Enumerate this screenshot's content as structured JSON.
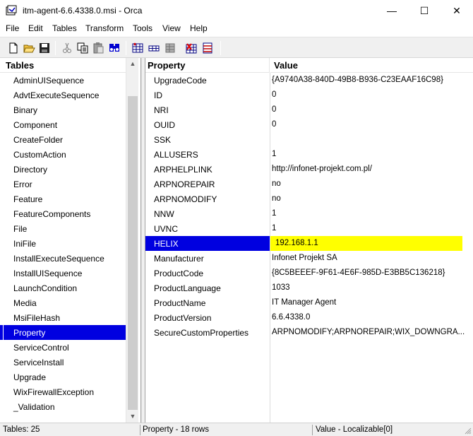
{
  "window": {
    "title": "itm-agent-6.6.4338.0.msi - Orca",
    "minimize_glyph": "—",
    "maximize_glyph": "☐",
    "close_glyph": "✕"
  },
  "menu": [
    {
      "label": "File"
    },
    {
      "label": "Edit"
    },
    {
      "label": "Tables"
    },
    {
      "label": "Transform"
    },
    {
      "label": "Tools"
    },
    {
      "label": "View"
    },
    {
      "label": "Help"
    }
  ],
  "toolbar": {
    "icons": [
      "new-file-icon",
      "open-folder-icon",
      "save-icon",
      "cut-icon",
      "copy-icon",
      "paste-icon",
      "find-icon",
      "add-table-icon",
      "add-row-icon",
      "drop-table-icon",
      "error-icon",
      "validate-icon"
    ]
  },
  "tables_pane": {
    "header": "Tables",
    "items": [
      {
        "label": "AdminUISequence"
      },
      {
        "label": "AdvtExecuteSequence"
      },
      {
        "label": "Binary"
      },
      {
        "label": "Component"
      },
      {
        "label": "CreateFolder"
      },
      {
        "label": "CustomAction"
      },
      {
        "label": "Directory"
      },
      {
        "label": "Error"
      },
      {
        "label": "Feature"
      },
      {
        "label": "FeatureComponents"
      },
      {
        "label": "File"
      },
      {
        "label": "IniFile"
      },
      {
        "label": "InstallExecuteSequence"
      },
      {
        "label": "InstallUISequence"
      },
      {
        "label": "LaunchCondition"
      },
      {
        "label": "Media"
      },
      {
        "label": "MsiFileHash"
      },
      {
        "label": "Property",
        "selected": true
      },
      {
        "label": "ServiceControl"
      },
      {
        "label": "ServiceInstall"
      },
      {
        "label": "Upgrade"
      },
      {
        "label": "WixFirewallException"
      },
      {
        "label": "_Validation"
      }
    ]
  },
  "grid": {
    "columns": {
      "property": "Property",
      "value": "Value"
    },
    "rows": [
      {
        "property": "UpgradeCode",
        "value": "{A9740A38-840D-49B8-B936-C23EAAF16C98}"
      },
      {
        "property": "ID",
        "value": "0"
      },
      {
        "property": "NRI",
        "value": "0"
      },
      {
        "property": "OUID",
        "value": "0"
      },
      {
        "property": "SSK",
        "value": ""
      },
      {
        "property": "ALLUSERS",
        "value": "1"
      },
      {
        "property": "ARPHELPLINK",
        "value": "http://infonet-projekt.com.pl/"
      },
      {
        "property": "ARPNOREPAIR",
        "value": "no"
      },
      {
        "property": "ARPNOMODIFY",
        "value": "no"
      },
      {
        "property": "NNW",
        "value": "1"
      },
      {
        "property": "UVNC",
        "value": "1"
      },
      {
        "property": "HELIX",
        "value": "192.168.1.1",
        "selected": true
      },
      {
        "property": "Manufacturer",
        "value": "Infonet Projekt SA"
      },
      {
        "property": "ProductCode",
        "value": "{8C5BEEEF-9F61-4E6F-985D-E3BB5C136218}"
      },
      {
        "property": "ProductLanguage",
        "value": "1033"
      },
      {
        "property": "ProductName",
        "value": "IT Manager Agent"
      },
      {
        "property": "ProductVersion",
        "value": "6.6.4338.0"
      },
      {
        "property": "SecureCustomProperties",
        "value": "ARPNOMODIFY;ARPNOREPAIR;WIX_DOWNGRA..."
      }
    ]
  },
  "status": {
    "tables": "Tables: 25",
    "rows": "Property - 18 rows",
    "column": "Value - Localizable[0]"
  },
  "colors": {
    "selection": "#0000e0",
    "edit_highlight": "#ffff00"
  }
}
